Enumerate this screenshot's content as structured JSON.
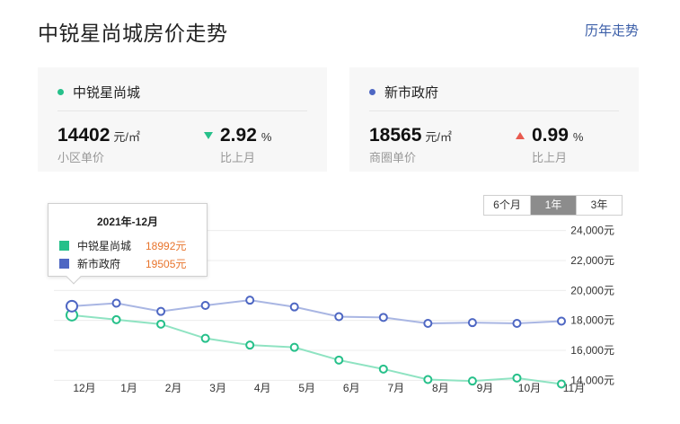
{
  "page": {
    "title": "中锐星尚城房价走势",
    "history_link": "历年走势"
  },
  "cards": [
    {
      "name": "中锐星尚城",
      "dot_color": "#26c08a",
      "price": "14402",
      "unit": "元/㎡",
      "price_label": "小区单价",
      "change": "2.92",
      "change_unit": "%",
      "direction": "down",
      "change_label": "比上月"
    },
    {
      "name": "新市政府",
      "dot_color": "#4e67c3",
      "price": "18565",
      "unit": "元/㎡",
      "price_label": "商圈单价",
      "change": "0.99",
      "change_unit": "%",
      "direction": "up",
      "change_label": "比上月"
    }
  ],
  "range_buttons": [
    {
      "label": "6个月",
      "active": false
    },
    {
      "label": "1年",
      "active": true
    },
    {
      "label": "3年",
      "active": false
    }
  ],
  "tooltip": {
    "title": "2021年-12月",
    "rows": [
      {
        "name": "中锐星尚城",
        "value": "18992元",
        "color": "#26c08a"
      },
      {
        "name": "新市政府",
        "value": "19505元",
        "color": "#4e67c3"
      }
    ]
  },
  "chart_data": {
    "type": "line",
    "categories": [
      "12月",
      "1月",
      "2月",
      "3月",
      "4月",
      "5月",
      "6月",
      "7月",
      "8月",
      "9月",
      "10月",
      "11月"
    ],
    "y_ticks": [
      "14,000元",
      "16,000元",
      "18,000元",
      "20,000元",
      "22,000元",
      "24,000元"
    ],
    "ylim": [
      13000,
      25000
    ],
    "series": [
      {
        "name": "中锐星尚城",
        "color": "#26c08a",
        "line_color": "#8fe3c2",
        "values": [
          18350,
          18050,
          17750,
          16800,
          16350,
          16200,
          15350,
          14750,
          14050,
          13950,
          14150,
          13750
        ]
      },
      {
        "name": "新市政府",
        "color": "#4e67c3",
        "line_color": "#a9b6e3",
        "values": [
          18950,
          19150,
          18600,
          19000,
          19350,
          18900,
          18250,
          18200,
          17800,
          17850,
          17800,
          17950
        ]
      }
    ],
    "highlight_index": 0,
    "grid": true
  }
}
